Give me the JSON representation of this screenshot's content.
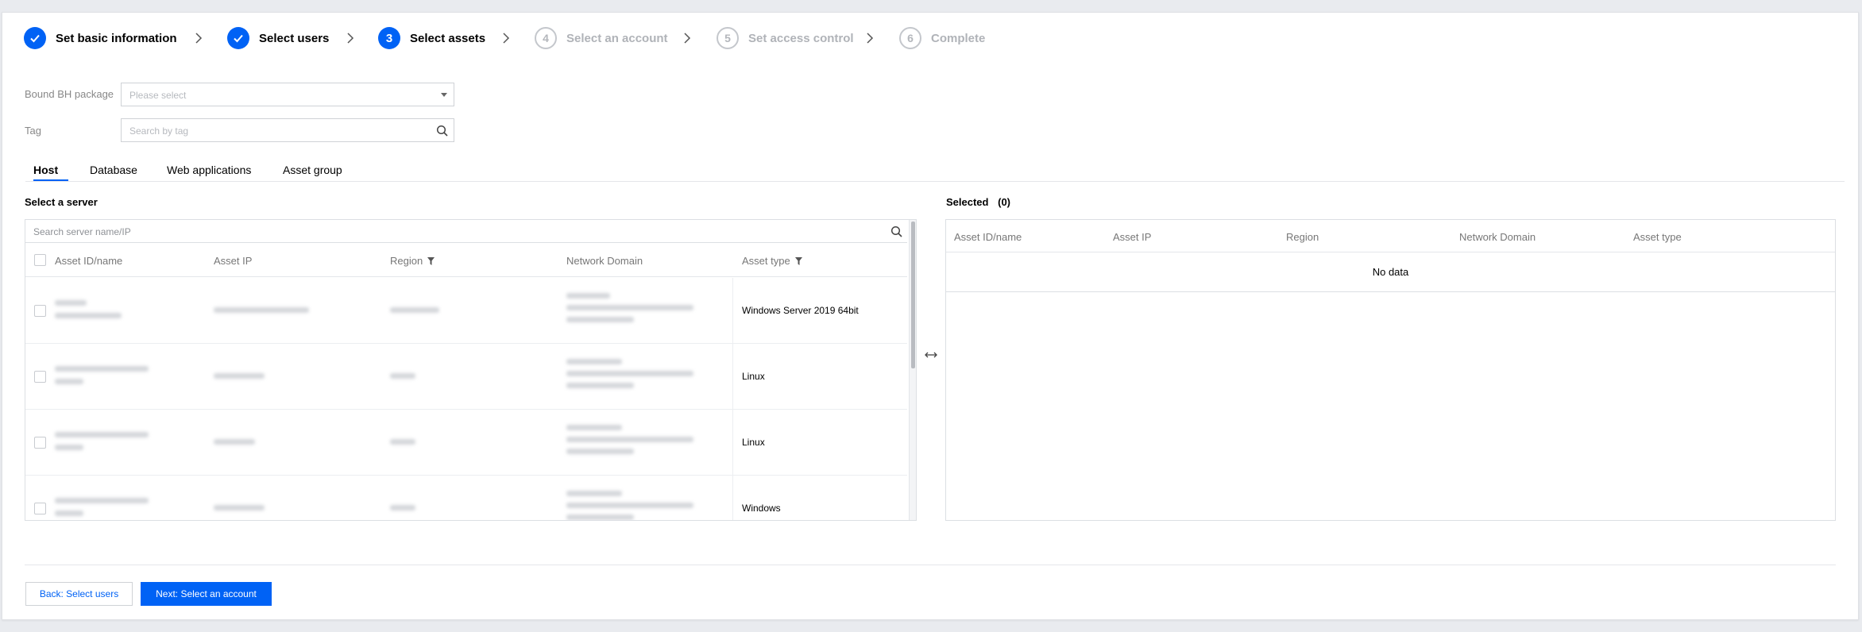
{
  "steps": [
    {
      "num": "",
      "label": "Set basic information",
      "state": "done"
    },
    {
      "num": "",
      "label": "Select users",
      "state": "done"
    },
    {
      "num": "3",
      "label": "Select assets",
      "state": "active"
    },
    {
      "num": "4",
      "label": "Select an account",
      "state": "todo"
    },
    {
      "num": "5",
      "label": "Set access control",
      "state": "todo"
    },
    {
      "num": "6",
      "label": "Complete",
      "state": "todo"
    }
  ],
  "form": {
    "bh_label": "Bound BH package",
    "bh_placeholder": "Please select",
    "tag_label": "Tag",
    "tag_placeholder": "Search by tag"
  },
  "tabs": [
    "Host",
    "Database",
    "Web applications",
    "Asset group"
  ],
  "left": {
    "title": "Select a server",
    "search_placeholder": "Search server name/IP",
    "columns": [
      "Asset ID/name",
      "Asset IP",
      "Region",
      "Network Domain",
      "Asset type"
    ],
    "rows": [
      {
        "asset_type": "Windows Server 2019 64bit"
      },
      {
        "asset_type": "Linux"
      },
      {
        "asset_type": "Linux"
      },
      {
        "asset_type": "Windows"
      }
    ]
  },
  "right": {
    "title": "Selected",
    "count": "(0)",
    "columns": [
      "Asset ID/name",
      "Asset IP",
      "Region",
      "Network Domain",
      "Asset type"
    ],
    "empty_text": "No data"
  },
  "footer": {
    "back_label": "Back: Select users",
    "next_label": "Next: Select an account"
  },
  "colors": {
    "accent": "#0062f5"
  }
}
